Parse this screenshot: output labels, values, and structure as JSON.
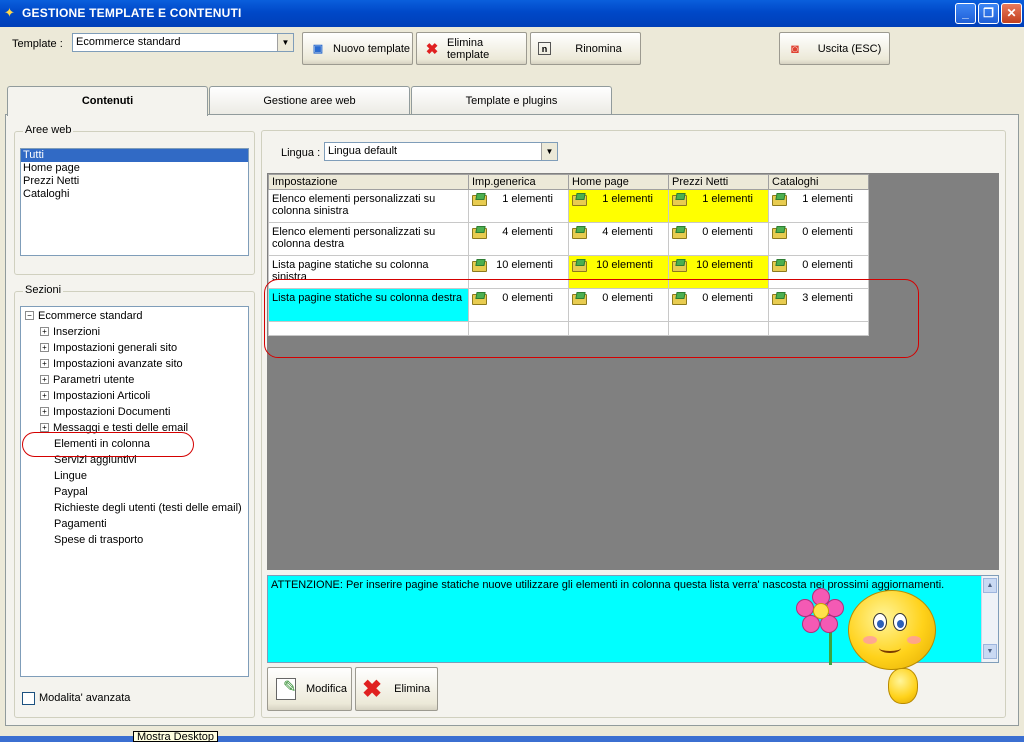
{
  "window": {
    "title": "GESTIONE TEMPLATE E CONTENUTI",
    "min": "_",
    "max": "❐",
    "close": "✕"
  },
  "toolbar": {
    "template_label": "Template :",
    "template_value": "Ecommerce standard",
    "new_template": "Nuovo template",
    "delete_template": "Elimina template",
    "rename": "Rinomina",
    "exit": "Uscita (ESC)"
  },
  "tabs": [
    "Contenuti",
    "Gestione aree web",
    "Template e plugins"
  ],
  "aree_web": {
    "title": "Aree web",
    "items": [
      "Tutti",
      "Home page",
      "Prezzi Netti",
      "Cataloghi"
    ],
    "selected_index": 0
  },
  "sezioni": {
    "title": "Sezioni",
    "root": "Ecommerce standard",
    "items": [
      {
        "label": "Inserzioni",
        "expandable": true
      },
      {
        "label": "Impostazioni generali sito",
        "expandable": true
      },
      {
        "label": "Impostazioni avanzate sito",
        "expandable": true
      },
      {
        "label": "Parametri utente",
        "expandable": true
      },
      {
        "label": "Impostazioni Articoli",
        "expandable": true
      },
      {
        "label": "Impostazioni Documenti",
        "expandable": true
      },
      {
        "label": "Messaggi e testi delle email",
        "expandable": true
      },
      {
        "label": "Elementi in colonna",
        "expandable": false
      },
      {
        "label": "Servizi aggiuntivi",
        "expandable": false
      },
      {
        "label": "Lingue",
        "expandable": false
      },
      {
        "label": "Paypal",
        "expandable": false
      },
      {
        "label": "Richieste degli utenti (testi delle email)",
        "expandable": false
      },
      {
        "label": "Pagamenti",
        "expandable": false
      },
      {
        "label": "Spese di trasporto",
        "expandable": false
      }
    ]
  },
  "lingua": {
    "label": "Lingua :",
    "value": "Lingua default"
  },
  "grid": {
    "headers": [
      "Impostazione",
      "Imp.generica",
      "Home page",
      "Prezzi Netti",
      "Cataloghi"
    ],
    "rows": [
      {
        "label": "Elenco elementi personalizzati su colonna sinistra",
        "values": [
          "1 elementi",
          "1 elementi",
          "1 elementi",
          "1 elementi"
        ],
        "highlight": [
          false,
          true,
          true,
          false
        ],
        "label_highlight": false
      },
      {
        "label": "Elenco elementi personalizzati su colonna destra",
        "values": [
          "4 elementi",
          "4 elementi",
          "0 elementi",
          "0 elementi"
        ],
        "highlight": [
          false,
          false,
          false,
          false
        ],
        "label_highlight": false
      },
      {
        "label": "Lista pagine statiche su colonna sinistra",
        "values": [
          "10 elementi",
          "10 elementi",
          "10 elementi",
          "0 elementi"
        ],
        "highlight": [
          false,
          true,
          true,
          false
        ],
        "label_highlight": false
      },
      {
        "label": "Lista pagine statiche su colonna destra",
        "values": [
          "0 elementi",
          "0 elementi",
          "0 elementi",
          "3 elementi"
        ],
        "highlight": [
          false,
          false,
          false,
          false
        ],
        "label_highlight": true
      }
    ]
  },
  "note": "ATTENZIONE: Per inserire pagine statiche nuove utilizzare gli elementi in colonna questa lista verra' nascosta nei prossimi aggiornamenti.",
  "buttons": {
    "edit": "Modifica",
    "delete": "Elimina"
  },
  "advanced_mode": "Modalita' avanzata",
  "tooltip": "Mostra Desktop",
  "colors": {
    "highlight": "#ffff00",
    "selected_row": "#00ffff",
    "title_bar": "#0048c8",
    "annotation": "#d40000"
  }
}
